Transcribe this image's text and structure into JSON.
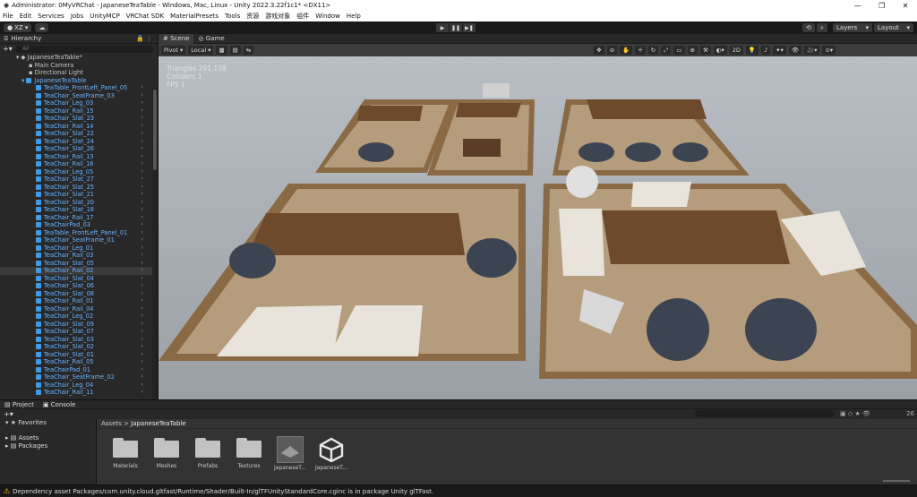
{
  "window": {
    "title": "Administrator: 0MyVRChat - JapaneseTeaTable - Windows, Mac, Linux - Unity 2022.3.22f1c1* <DX11>",
    "min": "—",
    "max": "❐",
    "close": "✕"
  },
  "menu": [
    "File",
    "Edit",
    "Services",
    "Jobs",
    "UnityMCP",
    "VRChat SDK",
    "MaterialPresets",
    "Tools",
    "资源",
    "游戏对象",
    "组件",
    "Window",
    "Help"
  ],
  "toolbar": {
    "account": "XZ ▾",
    "layers": "Layers",
    "layout": "Layout"
  },
  "hierarchy": {
    "tab": "Hierarchy",
    "search_placeholder": "All",
    "scene": "JapaneseTeaTable*",
    "root_items": [
      "Main Camera",
      "Directional Light"
    ],
    "group": "JapaneseTeaTable",
    "children": [
      "TeaTable_FrontLeft_Panel_05",
      "TeaChair_SeatFrame_03",
      "TeaChair_Leg_03",
      "TeaChair_Rail_15",
      "TeaChair_Slat_23",
      "TeaChair_Rail_14",
      "TeaChair_Slat_22",
      "TeaChair_Slat_24",
      "TeaChair_Slat_26",
      "TeaChair_Rail_13",
      "TeaChair_Rail_16",
      "TeaChair_Leg_05",
      "TeaChair_Slat_27",
      "TeaChair_Slat_25",
      "TeaChair_Slat_21",
      "TeaChair_Slat_20",
      "TeaChair_Slat_18",
      "TeaChair_Rail_17",
      "TeaChairPad_03",
      "TeaTable_FrontLeft_Panel_01",
      "TeaChair_SeatFrame_01",
      "TeaChair_Leg_01",
      "TeaChair_Rail_03",
      "TeaChair_Slat_05",
      "TeaChair_Rail_02",
      "TeaChair_Slat_04",
      "TeaChair_Slat_06",
      "TeaChair_Slat_08",
      "TeaChair_Rail_01",
      "TeaChair_Rail_04",
      "TeaChair_Leg_02",
      "TeaChair_Slat_09",
      "TeaChair_Slat_07",
      "TeaChair_Slat_03",
      "TeaChair_Slat_02",
      "TeaChair_Slat_01",
      "TeaChair_Rail_05",
      "TeaChairPad_01",
      "TeaChair_SeatFrame_02",
      "TeaChair_Leg_04",
      "TeaChair_Rail_11"
    ],
    "selected_index": 24
  },
  "scene": {
    "tabs": [
      "Scene",
      "Game"
    ],
    "pivot": "Pivot ▾",
    "local": "Local ▾",
    "mode_2d": "2D",
    "stats": [
      "Triangles 291,138",
      "Colliders 1",
      "FPS 1"
    ]
  },
  "project": {
    "tabs": [
      "Project",
      "Console"
    ],
    "favorites": "Favorites",
    "sidebar": [
      "Assets",
      "Packages"
    ],
    "breadcrumb": [
      "Assets",
      "JapaneseTeaTable"
    ],
    "assets": [
      "Materials",
      "Meshes",
      "Prefabs",
      "Textures",
      "JapaneseT...",
      "JapaneseT..."
    ],
    "count": "26"
  },
  "status": {
    "message": "Dependency asset Packages/com.unity.cloud.gltfast/Runtime/Shader/Built-In/glTFUnityStandardCore.cginc is in package Unity glTFast."
  },
  "colors": {
    "editor_bg": "#282828",
    "accent_blue": "#3d9be9",
    "warn": "#ffc107"
  }
}
